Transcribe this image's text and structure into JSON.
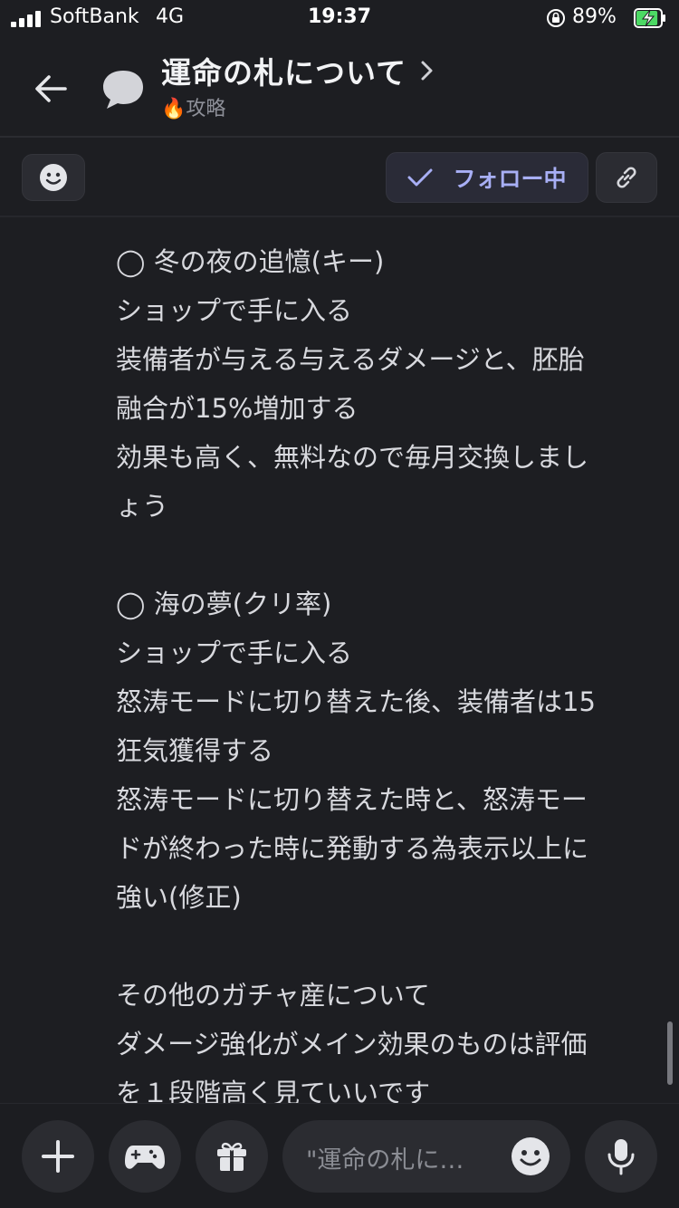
{
  "status_bar": {
    "carrier": "SoftBank",
    "network": "4G",
    "time": "19:37",
    "battery_percent": "89%",
    "battery_level": 0.89,
    "charging": true
  },
  "header": {
    "back_icon": "arrow-left-icon",
    "channel_icon": "chat-bubble-icon",
    "title": "運命の札について",
    "title_chevron": "chevron-right-icon",
    "subtitle": "🔥攻略"
  },
  "actions": {
    "emoji_icon": "smiley-icon",
    "follow_label": "フォロー中",
    "follow_icon": "checkmark-icon",
    "link_icon": "link-icon"
  },
  "message": {
    "lines": [
      "◯ 冬の夜の追憶(キー)",
      "ショップで手に入る",
      "装備者が与える与えるダメージと、胚胎",
      "融合が15%増加する",
      "効果も高く、無料なので毎月交換しまし",
      "ょう",
      "",
      "◯ 海の夢(クリ率)",
      "ショップで手に入る",
      "怒涛モードに切り替えた後、装備者は15",
      "狂気獲得する",
      "怒涛モードに切り替えた時と、怒涛モー",
      "ドが終わった時に発動する為表示以上に",
      "強い(修正)",
      "",
      "その他のガチャ産について",
      "ダメージ強化がメイン効果のものは評価",
      "を１段階高く見ていいです"
    ]
  },
  "bottom_bar": {
    "plus_icon": "plus-icon",
    "game_icon": "gamepad-icon",
    "gift_icon": "gift-icon",
    "input_placeholder": "\"運命の札に…",
    "input_emoji_icon": "smiley-icon",
    "mic_icon": "microphone-icon"
  },
  "colors": {
    "background": "#1d1e22",
    "text": "#d8d9de",
    "accent": "#a8aff5",
    "battery_green": "#4cd964"
  }
}
